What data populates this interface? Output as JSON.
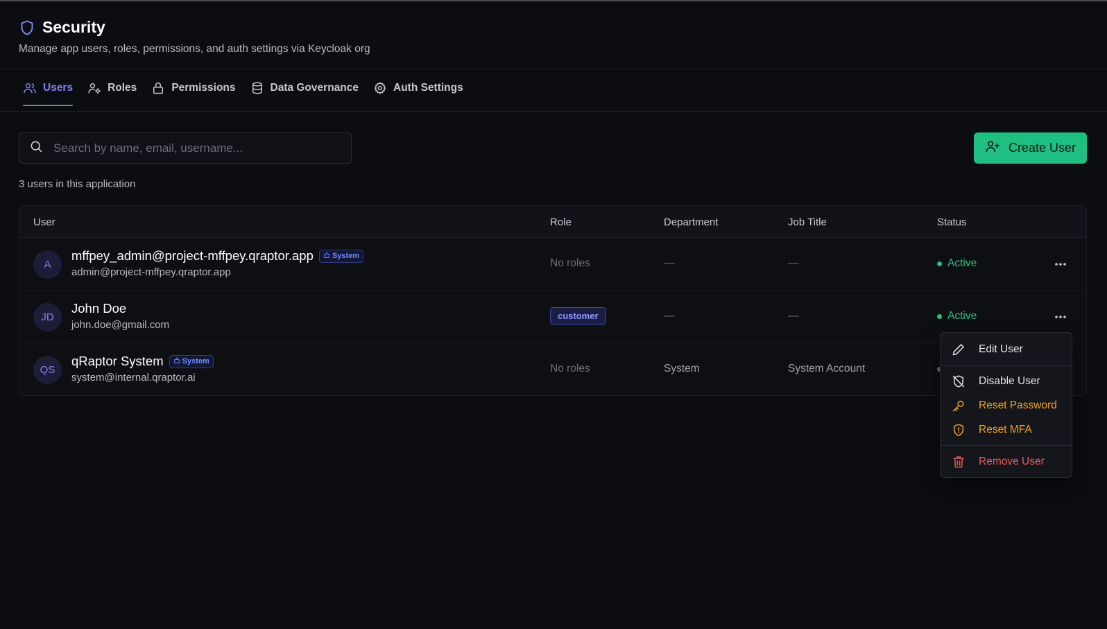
{
  "header": {
    "title": "Security",
    "subtitle": "Manage app users, roles, permissions, and auth settings via Keycloak org"
  },
  "tabs": [
    {
      "label": "Users",
      "icon": "users-icon",
      "active": true
    },
    {
      "label": "Roles",
      "icon": "user-cog-icon",
      "active": false
    },
    {
      "label": "Permissions",
      "icon": "lock-icon",
      "active": false
    },
    {
      "label": "Data Governance",
      "icon": "database-icon",
      "active": false
    },
    {
      "label": "Auth Settings",
      "icon": "gear-icon",
      "active": false
    }
  ],
  "search": {
    "placeholder": "Search by name, email, username...",
    "value": ""
  },
  "create_button": {
    "label": "Create User"
  },
  "count_text": "3 users in this application",
  "table": {
    "columns": [
      "User",
      "Role",
      "Department",
      "Job Title",
      "Status"
    ],
    "rows": [
      {
        "initials": "A",
        "name": "mffpey_admin@project-mffpey.qraptor.app",
        "badge": "System",
        "email": "admin@project-mffpey.qraptor.app",
        "role": "No roles",
        "department": "—",
        "job_title": "—",
        "status": "Active"
      },
      {
        "initials": "JD",
        "name": "John Doe",
        "badge": "",
        "email": "john.doe@gmail.com",
        "role": "customer",
        "department": "—",
        "job_title": "—",
        "status": "Active"
      },
      {
        "initials": "QS",
        "name": "qRaptor System",
        "badge": "System",
        "email": "system@internal.qraptor.ai",
        "role": "No roles",
        "department": "System",
        "job_title": "System Account",
        "status": ""
      }
    ]
  },
  "context_menu": {
    "items": [
      {
        "label": "Edit User",
        "icon": "pencil-icon"
      },
      {
        "label": "Disable User",
        "icon": "shield-off-icon"
      },
      {
        "label": "Reset Password",
        "icon": "key-icon"
      },
      {
        "label": "Reset MFA",
        "icon": "shield-alert-icon"
      },
      {
        "label": "Remove User",
        "icon": "trash-icon"
      }
    ]
  },
  "colors": {
    "background": "#0c0d11",
    "accent": "#6f77f0",
    "primary_button": "#1fbf84",
    "active_status": "#22c483",
    "warning": "#f0a02a",
    "danger": "#ec5a5a"
  }
}
